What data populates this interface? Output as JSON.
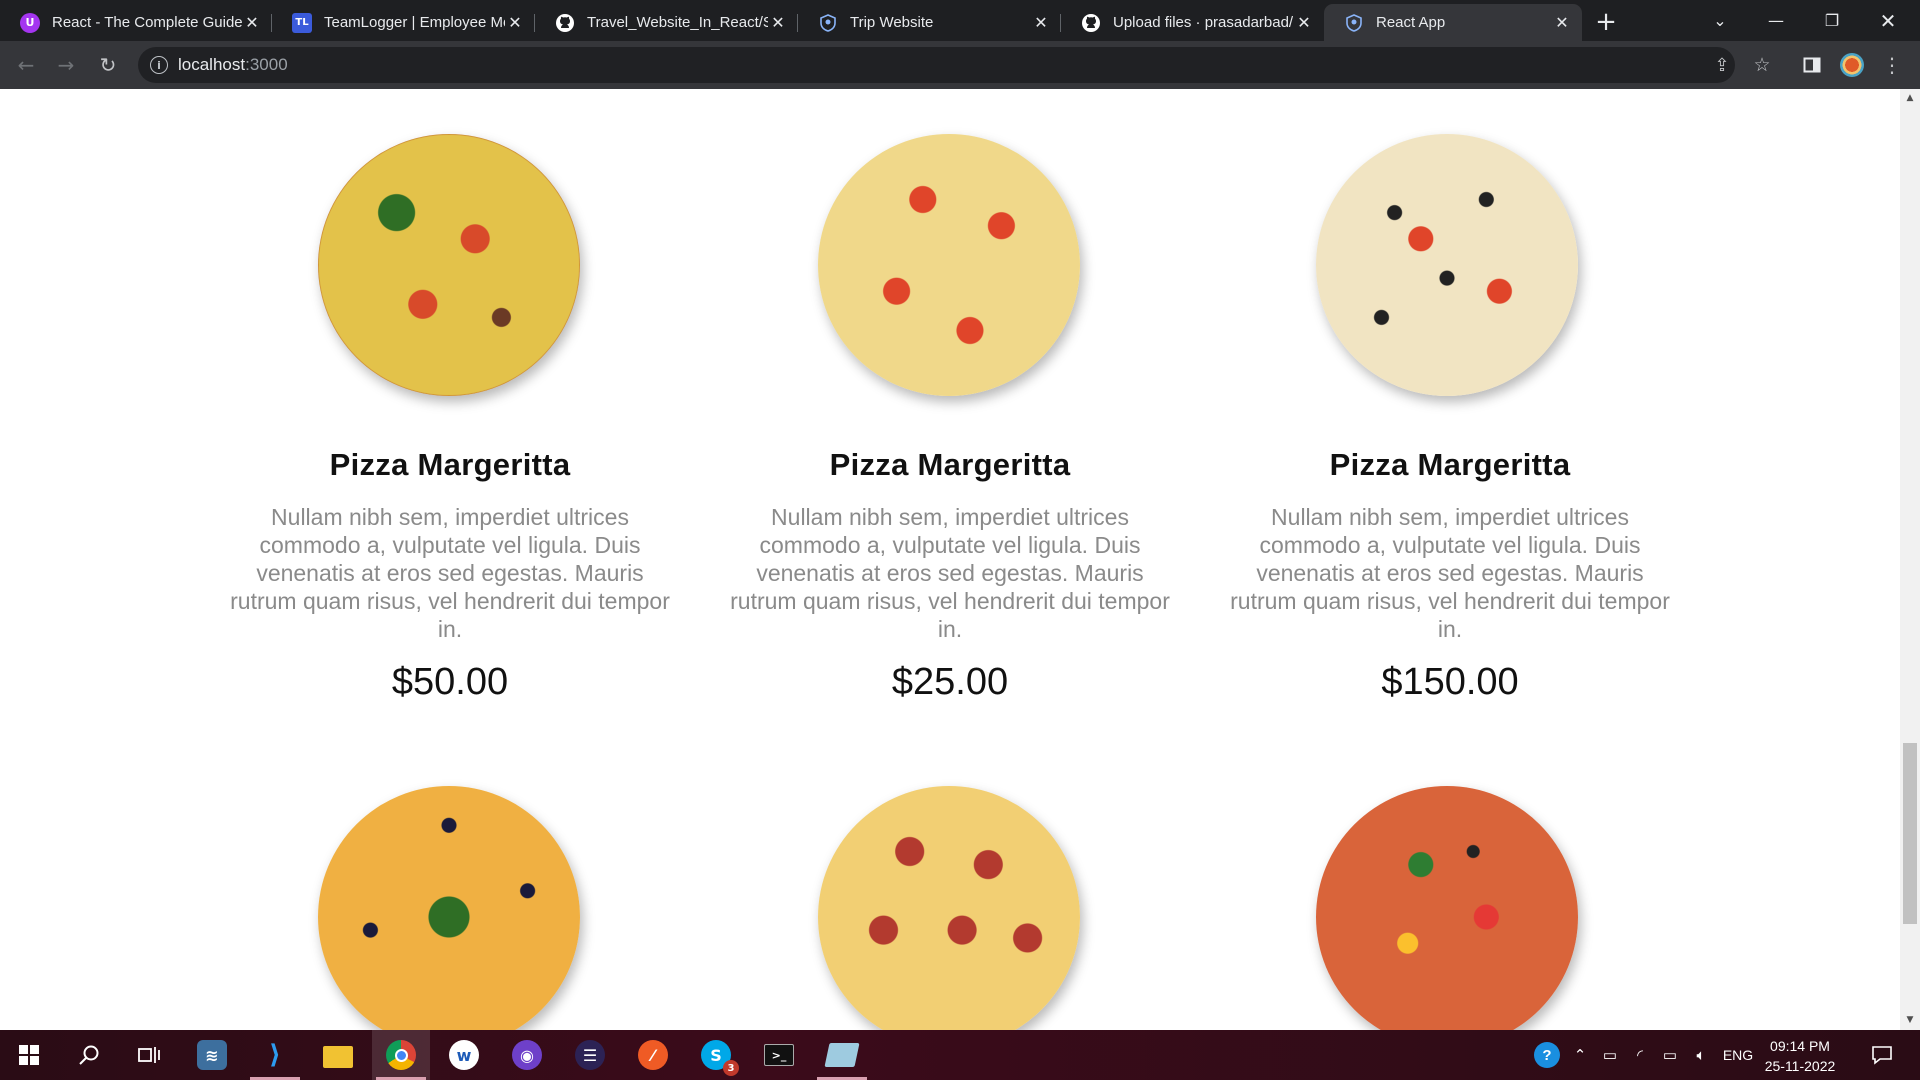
{
  "browser": {
    "tabs": [
      {
        "title": "React - The Complete Guide",
        "favicon": "udemy-icon",
        "favicon_color": "#a435f0",
        "favicon_text": "U"
      },
      {
        "title": "TeamLogger | Employee Monitoring",
        "favicon": "teamlogger-icon",
        "favicon_color": "#3b5bdb",
        "favicon_text": "TL"
      },
      {
        "title": "Travel_Website_In_React/Sc",
        "favicon": "github-icon",
        "favicon_color": "#ffffff",
        "favicon_text": ""
      },
      {
        "title": "Trip Website",
        "favicon": "shield-icon",
        "favicon_color": "#8ab4f8",
        "favicon_text": ""
      },
      {
        "title": "Upload files · prasadarbad/",
        "favicon": "github-icon",
        "favicon_color": "#ffffff",
        "favicon_text": ""
      },
      {
        "title": "React App",
        "favicon": "shield-icon",
        "favicon_color": "#8ab4f8",
        "favicon_text": "",
        "active": true
      }
    ],
    "address": {
      "host": "localhost",
      "port": ":3000"
    }
  },
  "menu": {
    "items": [
      {
        "name": "Pizza Margeritta",
        "description": "Nullam nibh sem, imperdiet ultrices commodo a, vulputate vel ligula. Duis venenatis at eros sed egestas. Mauris rutrum quam risus, vel hendrerit dui tempor in.",
        "price": "$50.00"
      },
      {
        "name": "Pizza Margeritta",
        "description": "Nullam nibh sem, imperdiet ultrices commodo a, vulputate vel ligula. Duis venenatis at eros sed egestas. Mauris rutrum quam risus, vel hendrerit dui tempor in.",
        "price": "$25.00"
      },
      {
        "name": "Pizza Margeritta",
        "description": "Nullam nibh sem, imperdiet ultrices commodo a, vulputate vel ligula. Duis venenatis at eros sed egestas. Mauris rutrum quam risus, vel hendrerit dui tempor in.",
        "price": "$150.00"
      }
    ]
  },
  "taskbar": {
    "skype_badge": "3",
    "language": "ENG",
    "time": "09:14 PM",
    "date": "25-11-2022"
  },
  "colors": {
    "tab_bar": "#1e1f22",
    "toolbar": "#35363a",
    "price_text": "#111111",
    "description_text": "#8a8a8a",
    "taskbar": "#3b0b1a"
  }
}
